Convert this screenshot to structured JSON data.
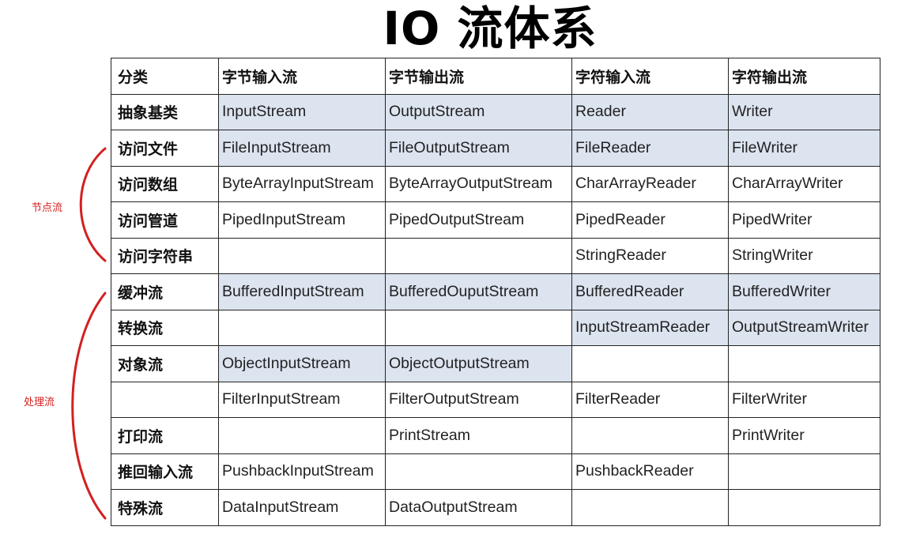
{
  "title": "IO 流体系",
  "side_labels": {
    "node_streams": "节点流",
    "processing_streams": "处理流"
  },
  "colors": {
    "highlight": "#dce4f0",
    "bracket": "#d32020"
  },
  "table": {
    "headers": [
      "分类",
      "字节输入流",
      "字节输出流",
      "字符输入流",
      "字符输出流"
    ],
    "rows": [
      {
        "category": "抽象基类",
        "cells": [
          "InputStream",
          "OutputStream",
          "Reader",
          "Writer"
        ],
        "highlight": [
          true,
          true,
          true,
          true
        ]
      },
      {
        "category": "访问文件",
        "cells": [
          "FileInputStream",
          "FileOutputStream",
          "FileReader",
          "FileWriter"
        ],
        "highlight": [
          true,
          true,
          true,
          true
        ]
      },
      {
        "category": "访问数组",
        "cells": [
          "ByteArrayInputStream",
          "ByteArrayOutputStream",
          "CharArrayReader",
          "CharArrayWriter"
        ],
        "highlight": [
          false,
          false,
          false,
          false
        ]
      },
      {
        "category": "访问管道",
        "cells": [
          "PipedInputStream",
          "PipedOutputStream",
          "PipedReader",
          "PipedWriter"
        ],
        "highlight": [
          false,
          false,
          false,
          false
        ]
      },
      {
        "category": "访问字符串",
        "cells": [
          "",
          "",
          "StringReader",
          "StringWriter"
        ],
        "highlight": [
          false,
          false,
          false,
          false
        ]
      },
      {
        "category": "缓冲流",
        "cells": [
          "BufferedInputStream",
          "BufferedOuputStream",
          "BufferedReader",
          "BufferedWriter"
        ],
        "highlight": [
          true,
          true,
          true,
          true
        ]
      },
      {
        "category": "转换流",
        "cells": [
          "",
          "",
          "InputStreamReader",
          "OutputStreamWriter"
        ],
        "highlight": [
          false,
          false,
          true,
          true
        ]
      },
      {
        "category": "对象流",
        "cells": [
          "ObjectInputStream",
          "ObjectOutputStream",
          "",
          ""
        ],
        "highlight": [
          true,
          true,
          false,
          false
        ]
      },
      {
        "category": "",
        "cells": [
          "FilterInputStream",
          "FilterOutputStream",
          "FilterReader",
          "FilterWriter"
        ],
        "highlight": [
          false,
          false,
          false,
          false
        ]
      },
      {
        "category": "打印流",
        "cells": [
          "",
          "PrintStream",
          "",
          "PrintWriter"
        ],
        "highlight": [
          false,
          false,
          false,
          false
        ]
      },
      {
        "category": "推回输入流",
        "cells": [
          "PushbackInputStream",
          "",
          "PushbackReader",
          ""
        ],
        "highlight": [
          false,
          false,
          false,
          false
        ]
      },
      {
        "category": "特殊流",
        "cells": [
          "DataInputStream",
          "DataOutputStream",
          "",
          ""
        ],
        "highlight": [
          false,
          false,
          false,
          false
        ]
      }
    ]
  }
}
